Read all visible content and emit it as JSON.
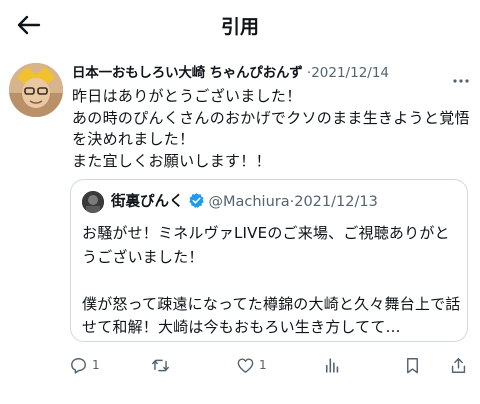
{
  "header": {
    "title": "引用"
  },
  "tweet": {
    "author_name": "日本一おもしろい大崎 ちゃんぴおんず",
    "dot": "·",
    "date": "2021/12/14",
    "text": "昨日はありがとうございました！\nあの時のぴんくさんのおかげでクソのまま生きようと覚悟を決めれました！\nまた宜しくお願いします！！"
  },
  "quote": {
    "author_name": "街裏ぴんく",
    "handle": "@Machiura",
    "dot": "·",
    "date": "2021/12/13",
    "text": "お騒がせ！ミネルヴァLIVEのご来場、ご視聴ありがとうございました！\n\n僕が怒って疎遠になってた樽錦の大崎と久々舞台上で話せて和解！大崎は今もおもろい生き方してて…"
  },
  "actions": {
    "reply_count": "1",
    "retweet_count": "",
    "like_count": "1"
  },
  "colors": {
    "verified": "#1d9bf0",
    "secondary_text": "#536471",
    "border": "#cfd9de"
  },
  "icons": [
    "back-arrow-icon",
    "more-icon",
    "verified-icon",
    "reply-icon",
    "retweet-icon",
    "like-icon",
    "views-icon",
    "bookmark-icon",
    "share-icon"
  ]
}
